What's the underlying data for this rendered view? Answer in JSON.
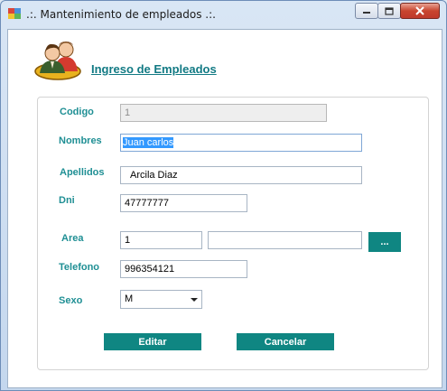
{
  "window": {
    "title": ".:. Mantenimiento de empleados .:.",
    "icon": "app-form-icon",
    "controls": [
      "minimize-icon",
      "maximize-icon",
      "close-icon"
    ]
  },
  "header": {
    "icon": "employees-icon",
    "title": "Ingreso de Empleados"
  },
  "form": {
    "codigo": {
      "label": "Codigo",
      "value": "1"
    },
    "nombres": {
      "label": "Nombres",
      "value": "Juan carlos"
    },
    "apellidos": {
      "label": "Apellidos",
      "value": "Arcila Diaz"
    },
    "dni": {
      "label": "Dni",
      "value": "47777777"
    },
    "area": {
      "label": "Area",
      "code": "1",
      "name": "",
      "browse_label": "..."
    },
    "telefono": {
      "label": "Telefono",
      "value": "996354121"
    },
    "sexo": {
      "label": "Sexo",
      "value": "M"
    }
  },
  "buttons": {
    "edit_label": "Editar",
    "cancel_label": "Cancelar"
  },
  "colors": {
    "accent": "#0f8682",
    "label": "#1f8f94",
    "selection": "#3399ff"
  }
}
